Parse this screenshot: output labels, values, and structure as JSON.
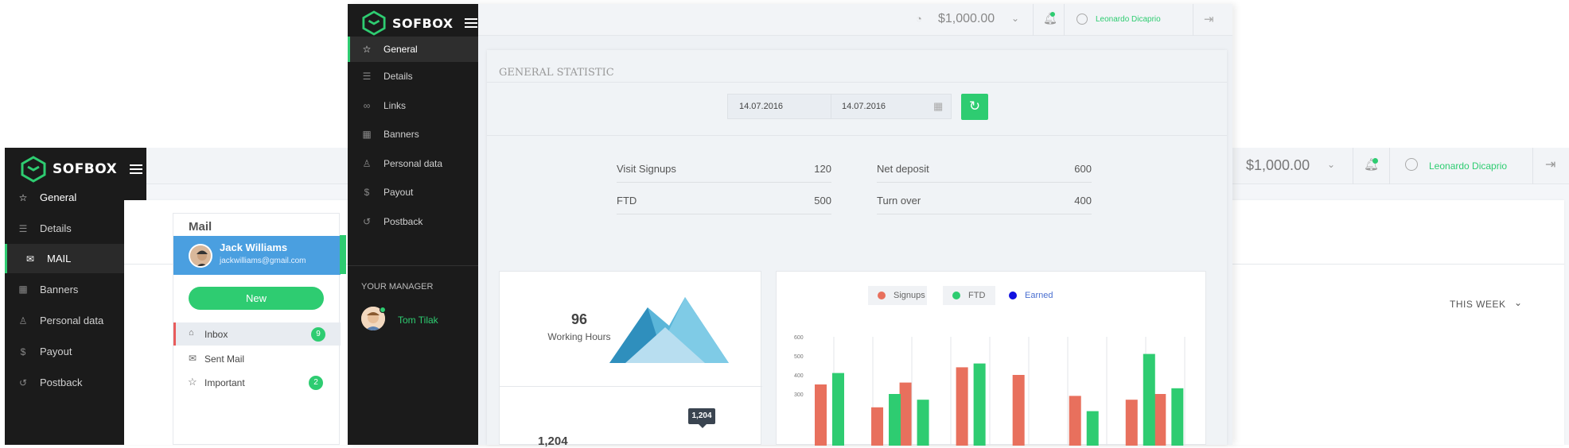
{
  "back": {
    "brand": "SOFBOX",
    "nav": [
      "General",
      "Details",
      "MAIL",
      "Banners",
      "Personal data",
      "Payout",
      "Postback"
    ],
    "balance": "$1,000.00",
    "user": "Leonardo Dicaprio",
    "mail": {
      "title": "Mail",
      "account_name": "Jack Williams",
      "account_email": "jackwilliams@gmail.com",
      "new_label": "New",
      "folders": [
        {
          "label": "Inbox",
          "count": "9"
        },
        {
          "label": "Sent Mail",
          "count": ""
        },
        {
          "label": "Important",
          "count": "2"
        }
      ]
    },
    "week_filter": "THIS WEEK"
  },
  "front": {
    "brand": "SOFBOX",
    "nav": [
      "General",
      "Details",
      "Links",
      "Banners",
      "Personal data",
      "Payout",
      "Postback"
    ],
    "manager_heading": "YOUR MANAGER",
    "manager_name": "Tom Tilak",
    "balance": "$1,000.00",
    "user": "Leonardo Dicaprio",
    "section_title": "GENERAL STATISTIC",
    "date_from": "14.07.2016",
    "date_to": "14.07.2016",
    "stats": [
      {
        "label": "Visit Signups",
        "value": "120"
      },
      {
        "label": "Net deposit",
        "value": "600"
      },
      {
        "label": "FTD",
        "value": "500"
      },
      {
        "label": "Turn over",
        "value": "400"
      }
    ],
    "hours_value": "96",
    "hours_label": "Working Hours",
    "second_value": "1,204",
    "tooltip": "1,204"
  },
  "colors": {
    "accent": "#2ecc71",
    "sidebar": "#1b1b1b",
    "mail_blue": "#4a9fe0",
    "signups": "#e8705d",
    "ftd": "#2ecc71",
    "earned": "#1010e0"
  },
  "chart_data": {
    "type": "bar",
    "legend": [
      "Signups",
      "FTD",
      "Earned"
    ],
    "y_ticks": [
      300,
      400,
      500,
      600
    ],
    "ylim": [
      0,
      600
    ],
    "series": [
      {
        "name": "Signups",
        "values": [
          350,
          null,
          230,
          360,
          null,
          440,
          null,
          400,
          null,
          290,
          null,
          270,
          300
        ]
      },
      {
        "name": "FTD",
        "values": [
          410,
          null,
          300,
          270,
          null,
          460,
          null,
          null,
          null,
          210,
          null,
          510,
          330
        ]
      }
    ]
  }
}
